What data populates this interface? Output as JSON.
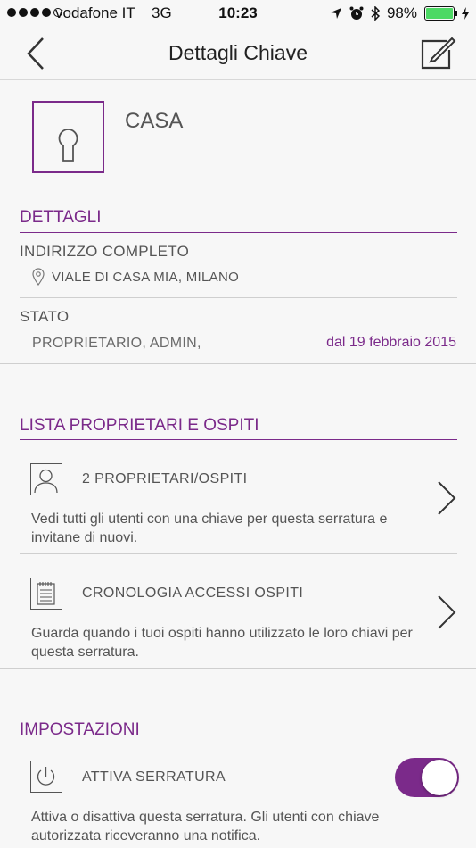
{
  "status_bar": {
    "carrier": "vodafone IT",
    "network": "3G",
    "time": "10:23",
    "battery": "98%",
    "battery_level": 0.98
  },
  "nav": {
    "title": "Dettagli Chiave",
    "back_icon": "chevron-left-icon",
    "edit_icon": "edit-icon"
  },
  "key": {
    "name": "CASA",
    "icon": "keyhole-icon"
  },
  "details": {
    "section_title": "DETTAGLI",
    "address_label": "INDIRIZZO COMPLETO",
    "address": "VIALE DI CASA MIA, MILANO",
    "status_label": "STATO",
    "status_value": "PROPRIETARIO, ADMIN,",
    "status_date": "dal 19 febbraio 2015"
  },
  "owners": {
    "section_title": "LISTA PROPRIETARI E OSPITI",
    "items": [
      {
        "title": "2 PROPRIETARI/OSPITI",
        "description": "Vedi tutti gli utenti con una chiave per questa serratura e invitane di nuovi.",
        "icon": "user-icon"
      },
      {
        "title": "CRONOLOGIA ACCESSI OSPITI",
        "description": "Guarda quando i tuoi ospiti hanno utilizzato le loro chiavi per questa serratura.",
        "icon": "notes-icon"
      }
    ]
  },
  "settings": {
    "section_title": "IMPOSTAZIONI",
    "lock_toggle_label": "ATTIVA SERRATURA",
    "lock_toggle_description": "Attiva o disattiva questa serratura. Gli utenti con chiave autorizzata riceveranno una notifica.",
    "lock_toggle_on": true,
    "icon": "power-icon"
  },
  "colors": {
    "accent": "#7b2a8a",
    "battery": "#4cd964"
  }
}
